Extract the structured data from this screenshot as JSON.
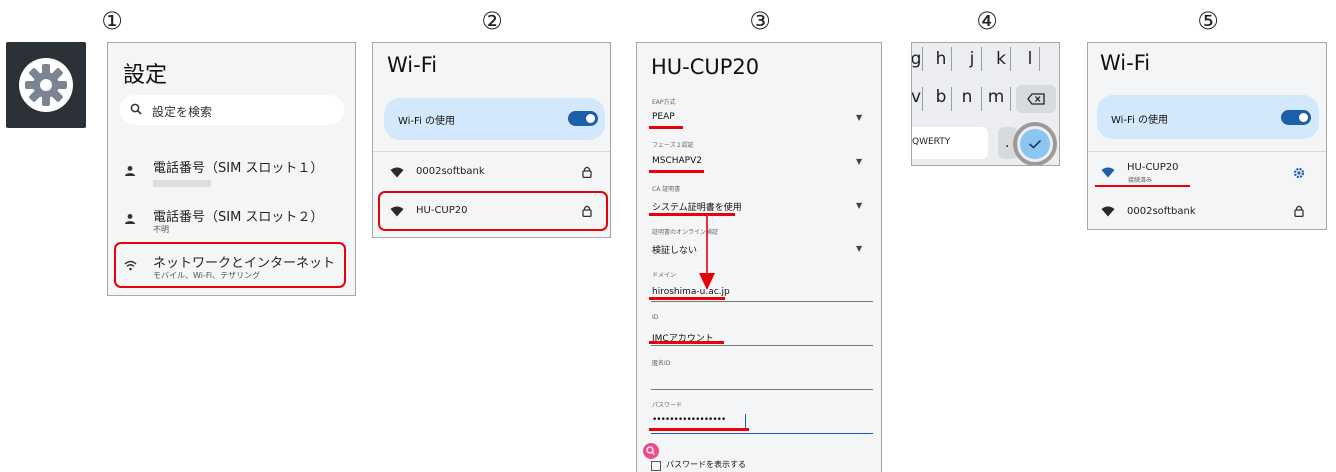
{
  "steps": [
    "①",
    "②",
    "③",
    "④",
    "⑤"
  ],
  "icons": {
    "settings_app": "gear-icon",
    "search": "search-icon",
    "person": "person-icon",
    "wifi": "wifi-icon",
    "lock": "lock-icon",
    "backspace": "backspace-icon",
    "check": "check-icon",
    "gear_small": "gear-icon",
    "magnifier": "zoom-icon"
  },
  "colors": {
    "highlight": "#e8000a",
    "toggle_on": "#1d5fa8",
    "card_bg": "#d3e9fb",
    "panel_bg": "#f4f5f7"
  },
  "settings_panel": {
    "title": "設定",
    "search_placeholder": "設定を検索",
    "items": [
      {
        "title": "電話番号（SIM スロット１）",
        "subtitle": ""
      },
      {
        "title": "電話番号（SIM スロット２）",
        "subtitle": "不明"
      },
      {
        "title": "ネットワークとインターネット",
        "subtitle": "モバイル、Wi-Fi、テザリング"
      }
    ]
  },
  "wifi_panel": {
    "title": "Wi-Fi",
    "toggle_label": "Wi-Fi の使用",
    "toggle_on": true,
    "networks": [
      {
        "name": "0002softbank",
        "locked": true
      },
      {
        "name": "HU-CUP20",
        "locked": true
      }
    ]
  },
  "config_panel": {
    "title": "HU-CUP20",
    "fields": [
      {
        "label": "EAP方式",
        "value": "PEAP"
      },
      {
        "label": "フェーズ２認証",
        "value": "MSCHAPV2"
      },
      {
        "label": "CA 証明書",
        "value": "システム証明書を使用"
      },
      {
        "label": "証明書のオンライン検証",
        "value": "検証しない"
      },
      {
        "label": "ドメイン",
        "value": "hiroshima-u.ac.jp"
      },
      {
        "label": "ID",
        "value": "IMCアカウント"
      },
      {
        "label": "匿名ID",
        "value": ""
      },
      {
        "label": "パスワード",
        "value": "•••••••••••••••••"
      }
    ],
    "show_password": "パスワードを表示する"
  },
  "keyboard_panel": {
    "row1": [
      "g",
      "h",
      "j",
      "k",
      "l"
    ],
    "row2": [
      "v",
      "b",
      "n",
      "m"
    ],
    "mode_key": "QWERTY",
    "period": "."
  },
  "connected_panel": {
    "title": "Wi-Fi",
    "toggle_label": "Wi-Fi の使用",
    "networks": [
      {
        "name": "HU-CUP20",
        "status": "接続済み"
      },
      {
        "name": "0002softbank"
      }
    ]
  }
}
